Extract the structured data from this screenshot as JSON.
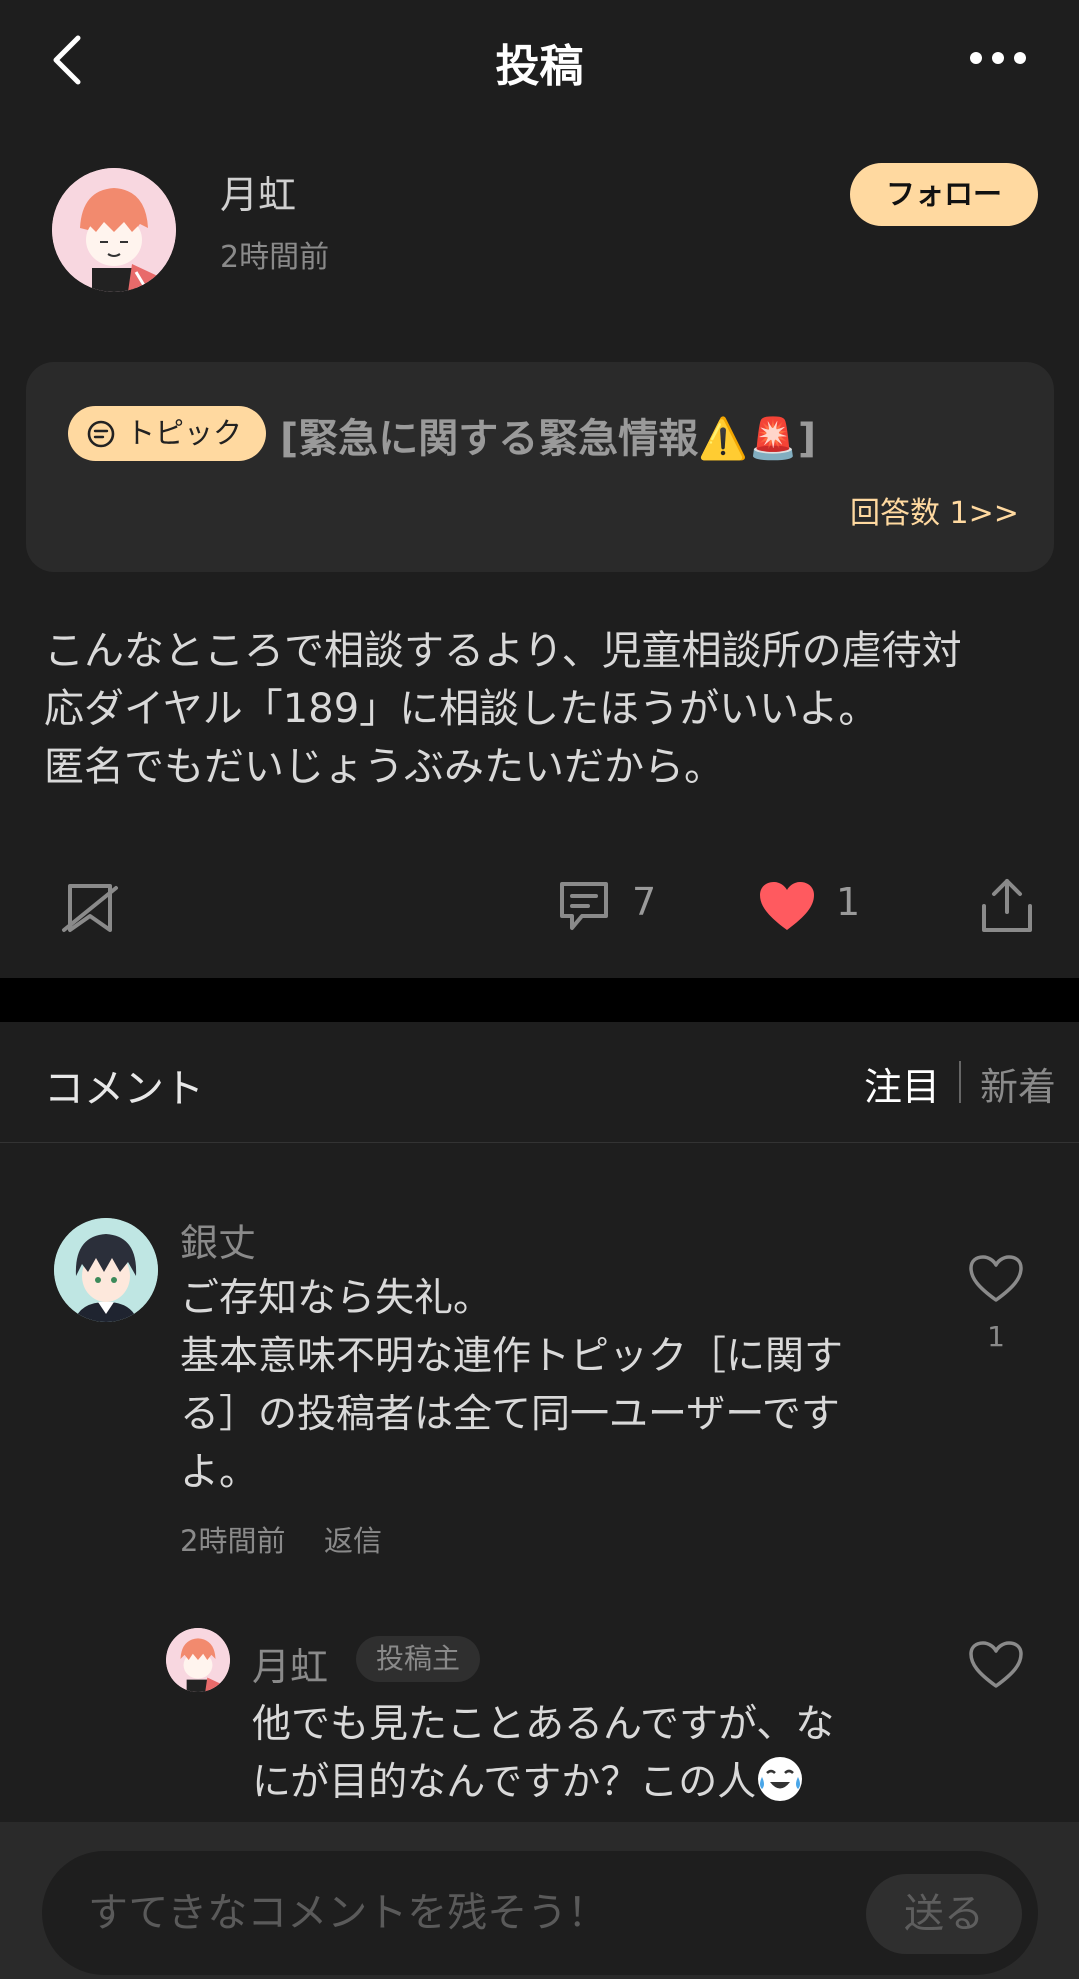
{
  "header": {
    "title": "投稿",
    "back_icon": "chevron-left-icon",
    "more_icon": "more-horizontal-icon"
  },
  "author": {
    "name": "月虹",
    "time": "2時間前",
    "follow_label": "フォロー"
  },
  "topic": {
    "badge_label": "トピック",
    "title": "[緊急に関する緊急情報⚠️🚨]",
    "answers": "回答数 1>>"
  },
  "post": {
    "body": "こんなところで相談するより、児童相談所の虐待対\n応ダイヤル「189」に相談したほうがいいよ。\n匿名でもだいじょうぶみたいだから。"
  },
  "actions": {
    "comment_count": "7",
    "like_count": "1"
  },
  "comments_section": {
    "title": "コメント",
    "sort_featured": "注目",
    "sort_new": "新着"
  },
  "comments": [
    {
      "name": "銀丈",
      "text": "ご存知なら失礼。\n基本意味不明な連作トピック［に関す\nる］の投稿者は全て同一ユーザーです\nよ。",
      "time": "2時間前",
      "reply_label": "返信",
      "like_count": "1"
    }
  ],
  "reply": {
    "name": "月虹",
    "badge": "投稿主",
    "text": "他でも見たことあるんですが、な\nにが目的なんですか？この人"
  },
  "composer": {
    "placeholder": "すてきなコメントを残そう！",
    "send_label": "送る"
  },
  "colors": {
    "accent": "#ffd9a0",
    "like_red": "#ff5a5f",
    "background": "#1e1e1e"
  }
}
